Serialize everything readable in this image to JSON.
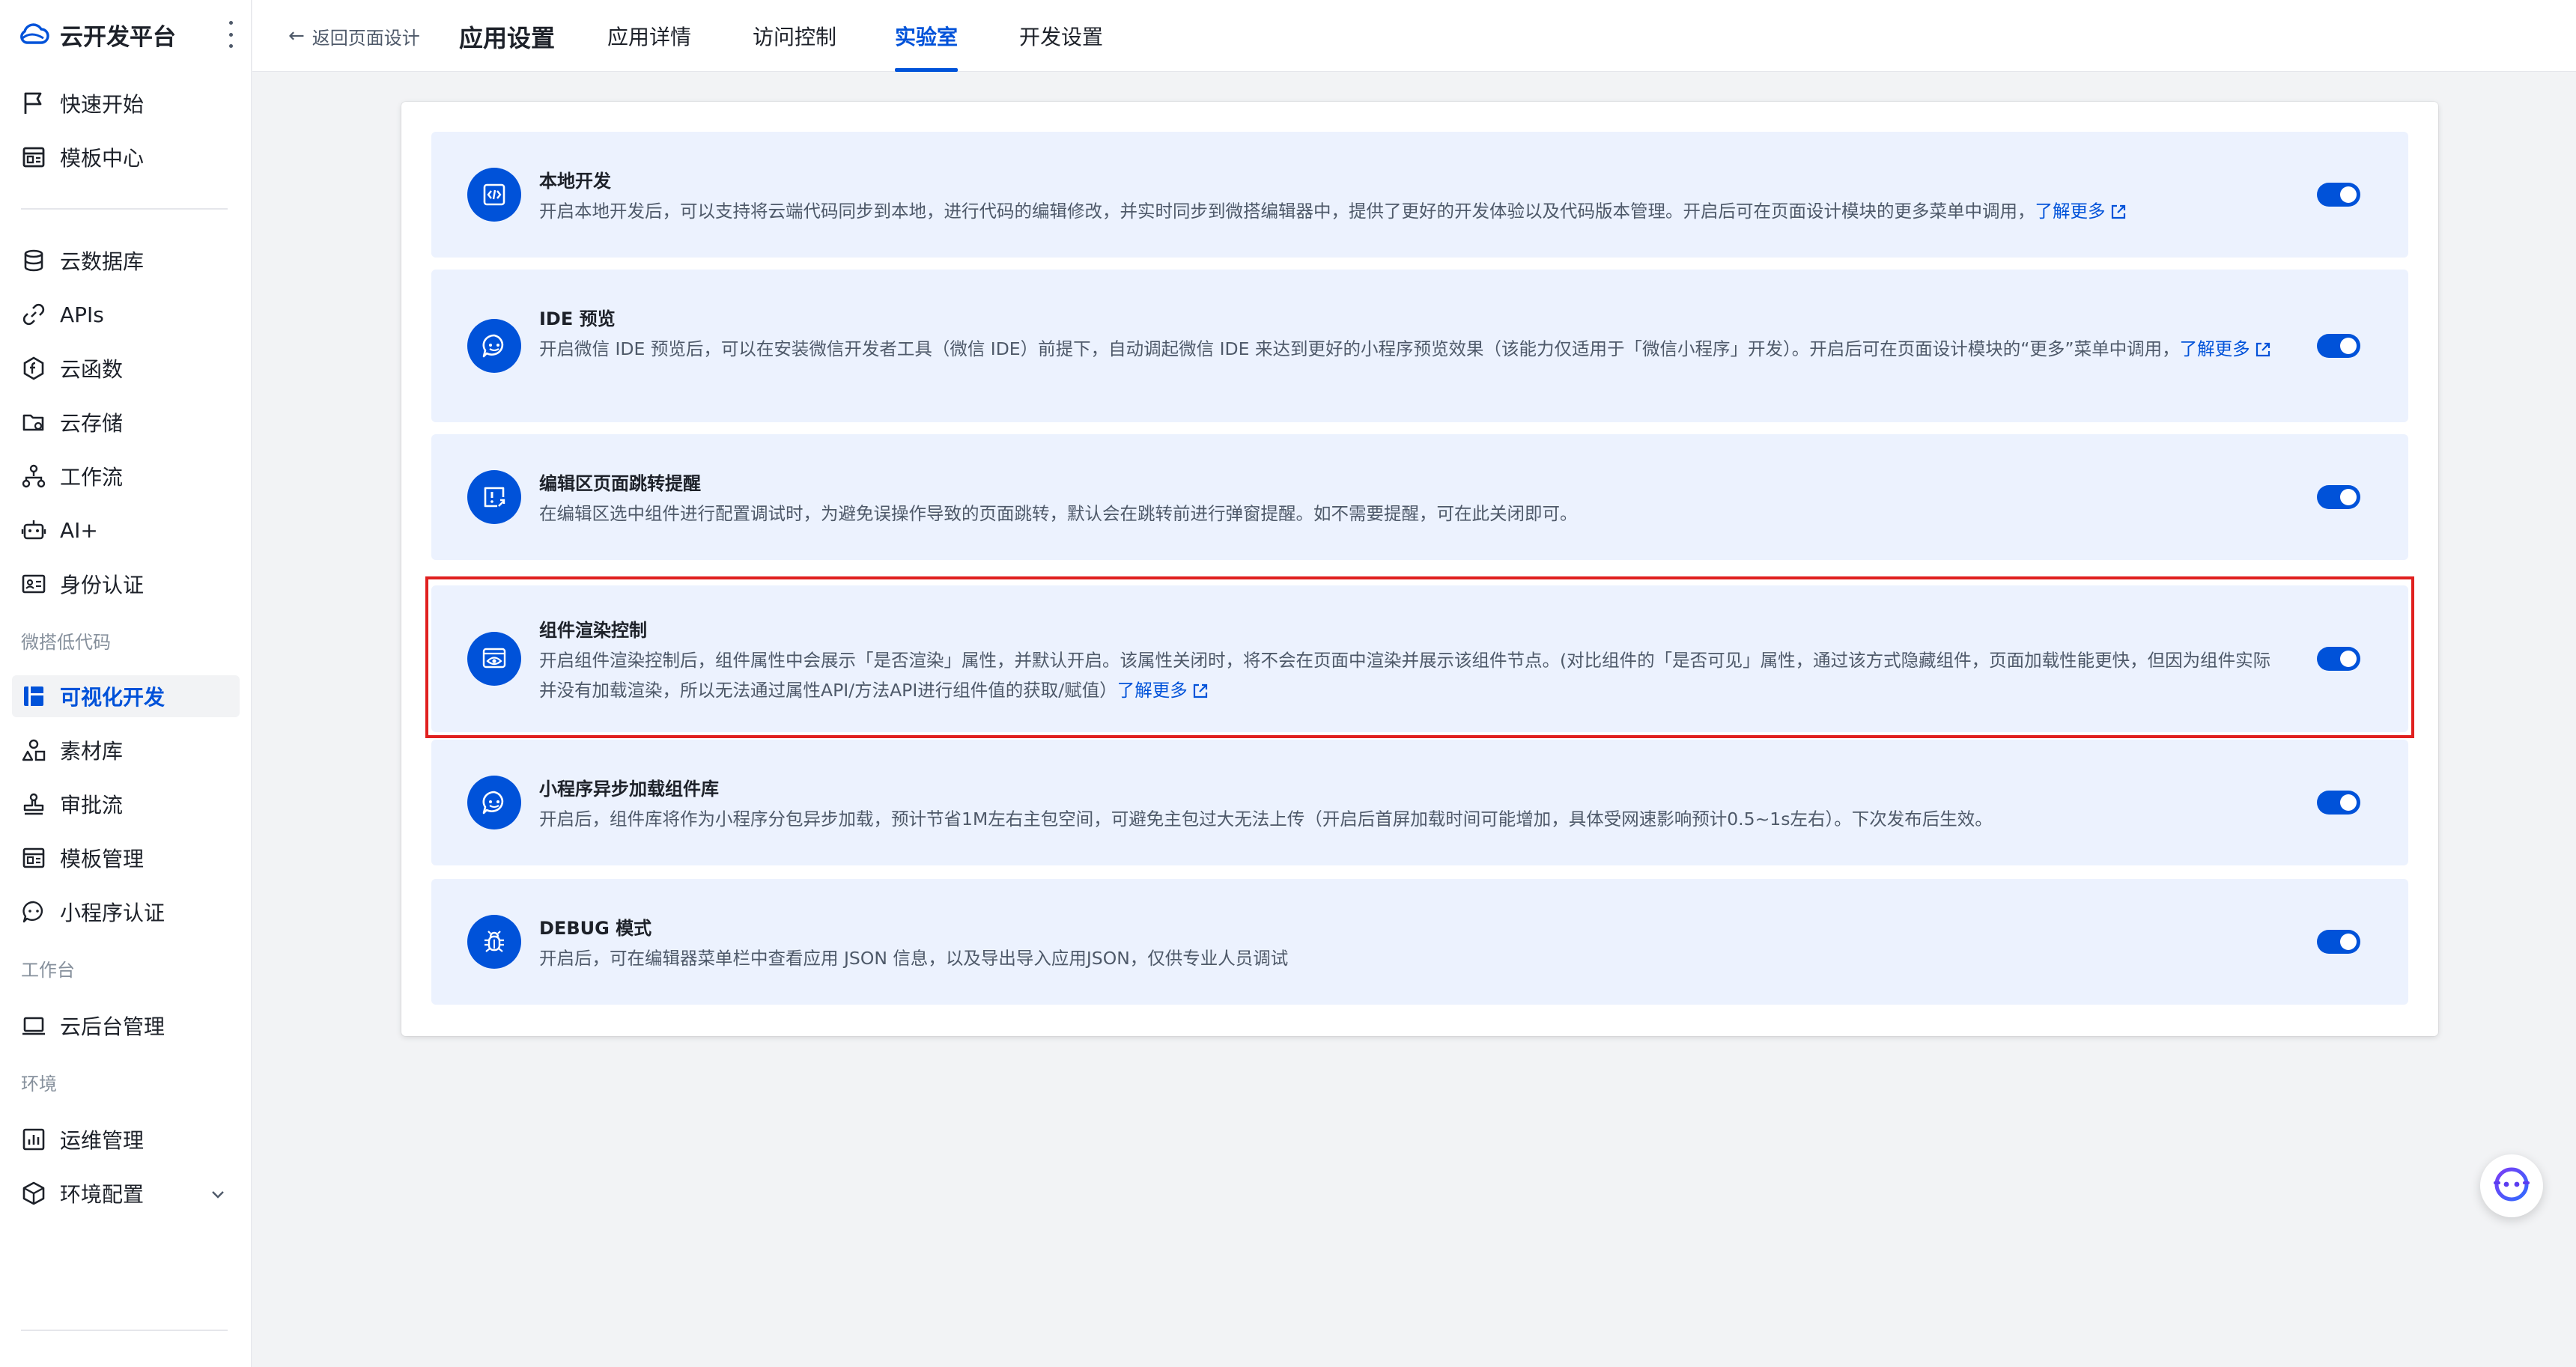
{
  "brand": {
    "name": "云开发平台"
  },
  "sidebar": {
    "items_top": [
      {
        "label": "快速开始",
        "icon": "flag-icon"
      },
      {
        "label": "模板中心",
        "icon": "template-icon"
      }
    ],
    "items_main": [
      {
        "label": "云数据库",
        "icon": "database-icon"
      },
      {
        "label": "APIs",
        "icon": "link-icon"
      },
      {
        "label": "云函数",
        "icon": "function-icon"
      },
      {
        "label": "云存储",
        "icon": "folder-icon"
      },
      {
        "label": "工作流",
        "icon": "workflow-icon"
      },
      {
        "label": "AI+",
        "icon": "robot-icon"
      },
      {
        "label": "身份认证",
        "icon": "id-card-icon"
      }
    ],
    "group_lowcode": "微搭低代码",
    "items_lowcode": [
      {
        "label": "可视化开发",
        "icon": "layout-icon",
        "active": true
      },
      {
        "label": "素材库",
        "icon": "shapes-icon"
      },
      {
        "label": "审批流",
        "icon": "stamp-icon"
      },
      {
        "label": "模板管理",
        "icon": "template-manage-icon"
      },
      {
        "label": "小程序认证",
        "icon": "miniprogram-icon"
      }
    ],
    "group_workbench": "工作台",
    "items_workbench": [
      {
        "label": "云后台管理",
        "icon": "laptop-icon"
      }
    ],
    "group_env": "环境",
    "items_env": [
      {
        "label": "运维管理",
        "icon": "chart-icon"
      },
      {
        "label": "环境配置",
        "icon": "cube-icon"
      }
    ]
  },
  "header": {
    "back_label": "返回页面设计",
    "title": "应用设置",
    "tabs": [
      {
        "label": "应用详情",
        "active": false
      },
      {
        "label": "访问控制",
        "active": false
      },
      {
        "label": "实验室",
        "active": true
      },
      {
        "label": "开发设置",
        "active": false
      }
    ]
  },
  "features": [
    {
      "title": "本地开发",
      "icon": "code-icon",
      "desc": "开启本地开发后，可以支持将云端代码同步到本地，进行代码的编辑修改，并实时同步到微搭编辑器中，提供了更好的开发体验以及代码版本管理。开启后可在页面设计模块的更多菜单中调用，",
      "learn_more": "了解更多",
      "enabled": true
    },
    {
      "title": "IDE 预览",
      "icon": "miniprogram-icon",
      "desc": "开启微信 IDE 预览后，可以在安装微信开发者工具（微信 IDE）前提下，自动调起微信 IDE 来达到更好的小程序预览效果（该能力仅适用于「微信小程序」开发）。开启后可在页面设计模块的“更多”菜单中调用，",
      "learn_more": "了解更多",
      "enabled": true
    },
    {
      "title": "编辑区页面跳转提醒",
      "icon": "alert-jump-icon",
      "desc": "在编辑区选中组件进行配置调试时，为避免误操作导致的页面跳转，默认会在跳转前进行弹窗提醒。如不需要提醒，可在此关闭即可。",
      "learn_more": "",
      "enabled": true
    },
    {
      "title": "组件渲染控制",
      "icon": "render-eye-icon",
      "desc": "开启组件渲染控制后，组件属性中会展示「是否渲染」属性，并默认开启。该属性关闭时，将不会在页面中渲染并展示该组件节点。(对比组件的「是否可见」属性，通过该方式隐藏组件，页面加载性能更快，但因为组件实际并没有加载渲染，所以无法通过属性API/方法API进行组件值的获取/赋值）",
      "learn_more": "了解更多",
      "enabled": true
    },
    {
      "title": "小程序异步加载组件库",
      "icon": "miniprogram-icon",
      "desc": "开启后，组件库将作为小程序分包异步加载，预计节省1M左右主包空间，可避免主包过大无法上传（开启后首屏加载时间可能增加，具体受网速影响预计0.5~1s左右）。下次发布后生效。",
      "learn_more": "",
      "enabled": true
    },
    {
      "title": "DEBUG 模式",
      "icon": "bug-icon",
      "desc": "开启后，可在编辑器菜单栏中查看应用 JSON 信息，以及导出导入应用JSON，仅供专业人员调试",
      "learn_more": "",
      "enabled": true
    }
  ],
  "colors": {
    "accent": "#0052d9",
    "card_bg": "#ecf2fe",
    "highlight": "#e0201f"
  },
  "fab": {
    "icon": "assistant-bot-icon"
  }
}
